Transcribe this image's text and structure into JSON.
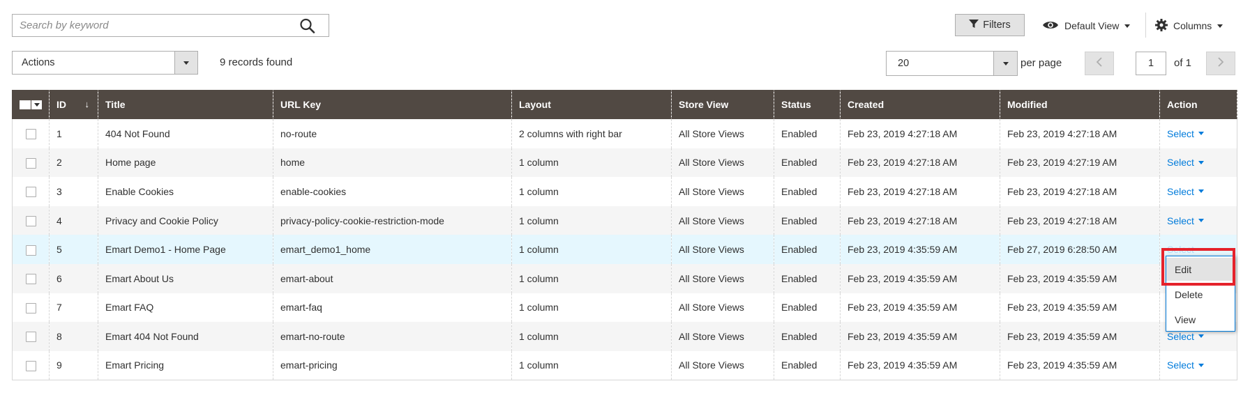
{
  "toolbar": {
    "search_placeholder": "Search by keyword",
    "filters_label": "Filters",
    "view_label": "Default View",
    "columns_label": "Columns",
    "actions_label": "Actions",
    "records_found": "9 records found",
    "per_page_value": "20",
    "per_page_label": "per page",
    "current_page": "1",
    "page_of": "of 1"
  },
  "columns": [
    "ID",
    "Title",
    "URL Key",
    "Layout",
    "Store View",
    "Status",
    "Created",
    "Modified",
    "Action"
  ],
  "rows": [
    {
      "id": "1",
      "title": "404 Not Found",
      "url_key": "no-route",
      "layout": "2 columns with right bar",
      "store_view": "All Store Views",
      "status": "Enabled",
      "created": "Feb 23, 2019 4:27:18 AM",
      "modified": "Feb 23, 2019 4:27:18 AM",
      "action": "Select"
    },
    {
      "id": "2",
      "title": "Home page",
      "url_key": "home",
      "layout": "1 column",
      "store_view": "All Store Views",
      "status": "Enabled",
      "created": "Feb 23, 2019 4:27:18 AM",
      "modified": "Feb 23, 2019 4:27:19 AM",
      "action": "Select"
    },
    {
      "id": "3",
      "title": "Enable Cookies",
      "url_key": "enable-cookies",
      "layout": "1 column",
      "store_view": "All Store Views",
      "status": "Enabled",
      "created": "Feb 23, 2019 4:27:18 AM",
      "modified": "Feb 23, 2019 4:27:18 AM",
      "action": "Select"
    },
    {
      "id": "4",
      "title": "Privacy and Cookie Policy",
      "url_key": "privacy-policy-cookie-restriction-mode",
      "layout": "1 column",
      "store_view": "All Store Views",
      "status": "Enabled",
      "created": "Feb 23, 2019 4:27:18 AM",
      "modified": "Feb 23, 2019 4:27:18 AM",
      "action": "Select"
    },
    {
      "id": "5",
      "title": "Emart Demo1 - Home Page",
      "url_key": "emart_demo1_home",
      "layout": "1 column",
      "store_view": "All Store Views",
      "status": "Enabled",
      "created": "Feb 23, 2019 4:35:59 AM",
      "modified": "Feb 27, 2019 6:28:50 AM",
      "action": "Select"
    },
    {
      "id": "6",
      "title": "Emart About Us",
      "url_key": "emart-about",
      "layout": "1 column",
      "store_view": "All Store Views",
      "status": "Enabled",
      "created": "Feb 23, 2019 4:35:59 AM",
      "modified": "Feb 23, 2019 4:35:59 AM",
      "action": ""
    },
    {
      "id": "7",
      "title": "Emart FAQ",
      "url_key": "emart-faq",
      "layout": "1 column",
      "store_view": "All Store Views",
      "status": "Enabled",
      "created": "Feb 23, 2019 4:35:59 AM",
      "modified": "Feb 23, 2019 4:35:59 AM",
      "action": ""
    },
    {
      "id": "8",
      "title": "Emart 404 Not Found",
      "url_key": "emart-no-route",
      "layout": "1 column",
      "store_view": "All Store Views",
      "status": "Enabled",
      "created": "Feb 23, 2019 4:35:59 AM",
      "modified": "Feb 23, 2019 4:35:59 AM",
      "action": "Select"
    },
    {
      "id": "9",
      "title": "Emart Pricing",
      "url_key": "emart-pricing",
      "layout": "1 column",
      "store_view": "All Store Views",
      "status": "Enabled",
      "created": "Feb 23, 2019 4:35:59 AM",
      "modified": "Feb 23, 2019 4:35:59 AM",
      "action": "Select"
    }
  ],
  "action_menu": {
    "items": [
      "Edit",
      "Delete",
      "View"
    ]
  },
  "colors": {
    "header_bg": "#514943",
    "link": "#007bdb",
    "hover_row": "#e5f7fe",
    "highlight": "#e5222b"
  }
}
